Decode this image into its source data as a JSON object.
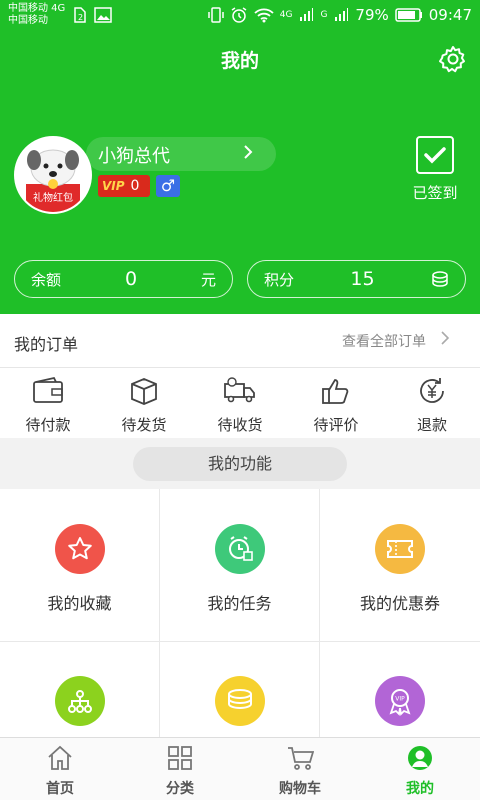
{
  "status_bar": {
    "carrier1": "中国移动 4G",
    "carrier2": "中国移动",
    "net1": "4G",
    "net2": "G",
    "battery": "79%",
    "time": "09:47"
  },
  "header": {
    "title": "我的",
    "username": "小狗总代",
    "vip_text": "VIP",
    "vip_level": "0",
    "gender_symbol": "♂",
    "avatar_text": "礼物红包",
    "signin_label": "已签到",
    "balance_label": "余额",
    "balance_value": "0",
    "balance_unit": "元",
    "points_label": "积分",
    "points_value": "15"
  },
  "orders": {
    "title": "我的订单",
    "view_all": "查看全部订单",
    "items": [
      {
        "label": "待付款",
        "icon": "wallet-icon"
      },
      {
        "label": "待发货",
        "icon": "box-icon"
      },
      {
        "label": "待收货",
        "icon": "truck-icon"
      },
      {
        "label": "待评价",
        "icon": "thumbs-up-icon"
      },
      {
        "label": "退款",
        "icon": "refund-icon"
      }
    ]
  },
  "functions": {
    "title": "我的功能",
    "items": [
      {
        "label": "我的收藏",
        "icon": "star-icon",
        "color": "#f0544a"
      },
      {
        "label": "我的任务",
        "icon": "clock-icon",
        "color": "#3ec97a"
      },
      {
        "label": "我的优惠券",
        "icon": "ticket-icon",
        "color": "#f5b941"
      },
      {
        "label": "",
        "icon": "network-icon",
        "color": "#8cd21e"
      },
      {
        "label": "",
        "icon": "coins-icon",
        "color": "#f6d12e"
      },
      {
        "label": "",
        "icon": "vip-ribbon-icon",
        "color": "#b265d6"
      }
    ]
  },
  "tabs": [
    {
      "label": "首页",
      "icon": "home-icon"
    },
    {
      "label": "分类",
      "icon": "category-icon"
    },
    {
      "label": "购物车",
      "icon": "cart-icon"
    },
    {
      "label": "我的",
      "icon": "profile-icon"
    }
  ],
  "colors": {
    "brand_green": "#1fbf28",
    "vip_red": "#d92a1c",
    "gender_blue": "#3b6fe6"
  }
}
